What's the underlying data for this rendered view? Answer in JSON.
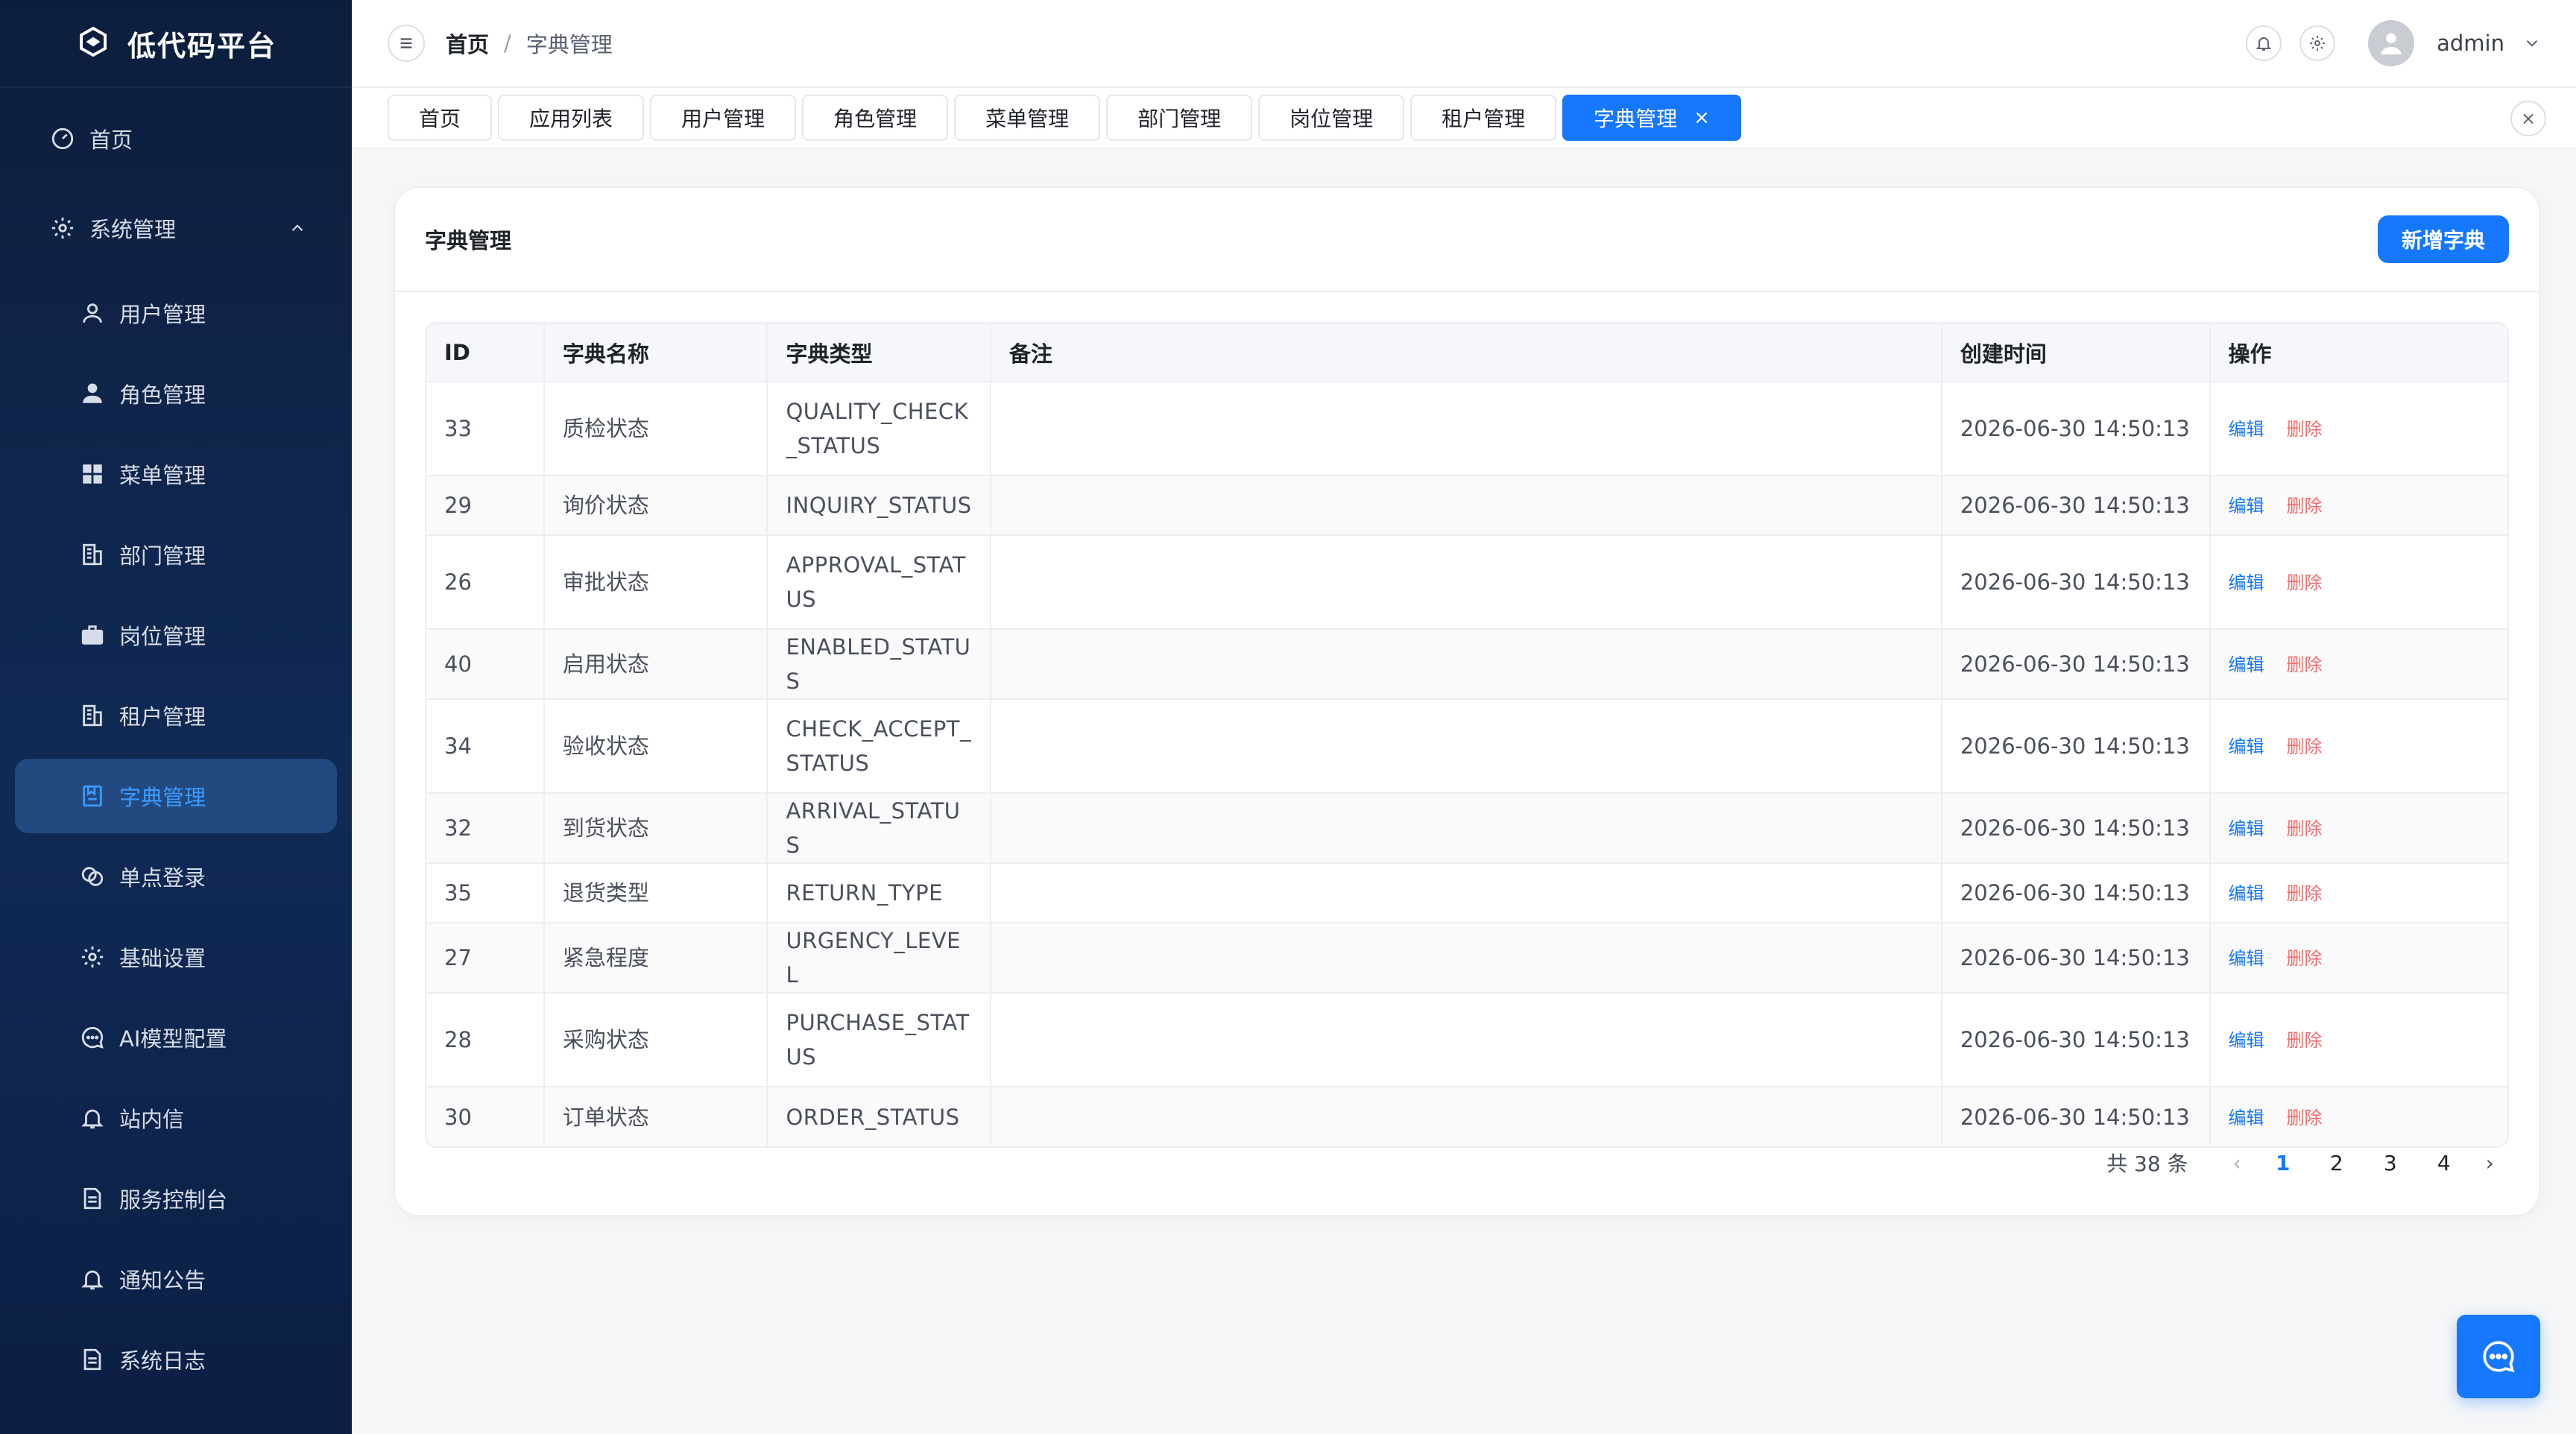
{
  "app": {
    "title": "低代码平台"
  },
  "sidebar": {
    "home": "首页",
    "system": "系统管理",
    "items": [
      {
        "label": "用户管理",
        "icon": "user-icon"
      },
      {
        "label": "角色管理",
        "icon": "role-icon"
      },
      {
        "label": "菜单管理",
        "icon": "grid-icon"
      },
      {
        "label": "部门管理",
        "icon": "building-icon"
      },
      {
        "label": "岗位管理",
        "icon": "briefcase-icon"
      },
      {
        "label": "租户管理",
        "icon": "building-icon"
      },
      {
        "label": "字典管理",
        "icon": "book-icon"
      },
      {
        "label": "单点登录",
        "icon": "link-icon"
      },
      {
        "label": "基础设置",
        "icon": "gear-icon"
      },
      {
        "label": "AI模型配置",
        "icon": "chat-icon"
      },
      {
        "label": "站内信",
        "icon": "bell-icon"
      },
      {
        "label": "服务控制台",
        "icon": "file-icon"
      },
      {
        "label": "通知公告",
        "icon": "bell-icon"
      },
      {
        "label": "系统日志",
        "icon": "file-icon"
      }
    ]
  },
  "header": {
    "breadcrumb": [
      "首页",
      "字典管理"
    ],
    "separator": "/",
    "username": "admin"
  },
  "tabs": [
    "首页",
    "应用列表",
    "用户管理",
    "角色管理",
    "菜单管理",
    "部门管理",
    "岗位管理",
    "租户管理",
    "字典管理"
  ],
  "tab_close": "×",
  "card": {
    "title": "字典管理",
    "add_button": "新增字典"
  },
  "table": {
    "columns": [
      "ID",
      "字典名称",
      "字典类型",
      "备注",
      "创建时间",
      "操作"
    ],
    "rows": [
      {
        "id": "33",
        "name": "质检状态",
        "type": "QUALITY_CHECK_STATUS",
        "remark": "",
        "created": "2026-06-30 14:50:13"
      },
      {
        "id": "29",
        "name": "询价状态",
        "type": "INQUIRY_STATUS",
        "remark": "",
        "created": "2026-06-30 14:50:13"
      },
      {
        "id": "26",
        "name": "审批状态",
        "type": "APPROVAL_STATUS",
        "remark": "",
        "created": "2026-06-30 14:50:13"
      },
      {
        "id": "40",
        "name": "启用状态",
        "type": "ENABLED_STATUS",
        "remark": "",
        "created": "2026-06-30 14:50:13"
      },
      {
        "id": "34",
        "name": "验收状态",
        "type": "CHECK_ACCEPT_STATUS",
        "remark": "",
        "created": "2026-06-30 14:50:13"
      },
      {
        "id": "32",
        "name": "到货状态",
        "type": "ARRIVAL_STATUS",
        "remark": "",
        "created": "2026-06-30 14:50:13"
      },
      {
        "id": "35",
        "name": "退货类型",
        "type": "RETURN_TYPE",
        "remark": "",
        "created": "2026-06-30 14:50:13"
      },
      {
        "id": "27",
        "name": "紧急程度",
        "type": "URGENCY_LEVEL",
        "remark": "",
        "created": "2026-06-30 14:50:13"
      },
      {
        "id": "28",
        "name": "采购状态",
        "type": "PURCHASE_STATUS",
        "remark": "",
        "created": "2026-06-30 14:50:13"
      },
      {
        "id": "30",
        "name": "订单状态",
        "type": "ORDER_STATUS",
        "remark": "",
        "created": "2026-06-30 14:50:13"
      }
    ],
    "edit_label": "编辑",
    "delete_label": "删除"
  },
  "pagination": {
    "total": "共 38 条",
    "pages": [
      "1",
      "2",
      "3",
      "4"
    ],
    "current": "1",
    "prev": "‹",
    "next": "›"
  },
  "colors": {
    "primary": "#1677ff",
    "danger": "#f56c6c",
    "sidebar_bg": "#0d1e3d",
    "active_bg": "#234a80"
  }
}
